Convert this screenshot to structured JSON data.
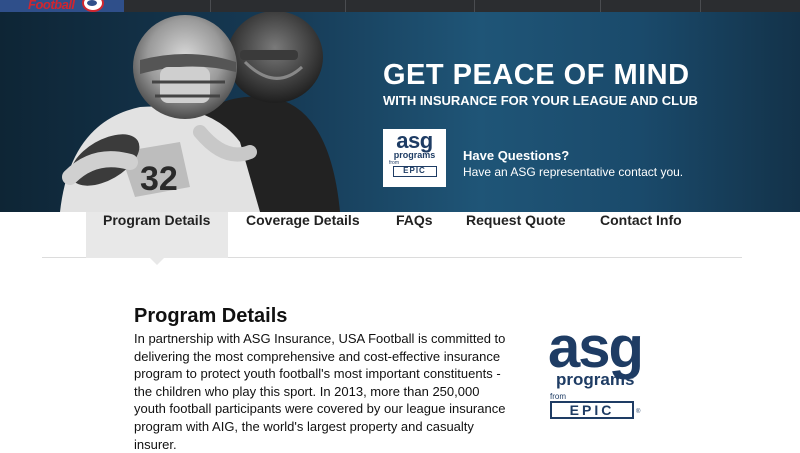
{
  "brand": {
    "logo_text": "Football"
  },
  "hero": {
    "title": "GET PEACE OF MIND",
    "subtitle": "WITH INSURANCE FOR YOUR LEAGUE AND CLUB",
    "asg_logo": {
      "asg": "asg",
      "programs": "programs",
      "from": "from",
      "epic": "EPIC"
    },
    "question_title": "Have Questions?",
    "question_text": "Have an ASG representative contact you.",
    "photo_description": "youth-football-players-photo"
  },
  "tabs": [
    {
      "label": "Program Details",
      "active": true
    },
    {
      "label": "Coverage Details",
      "active": false
    },
    {
      "label": "FAQs",
      "active": false
    },
    {
      "label": "Request Quote",
      "active": false
    },
    {
      "label": "Contact Info",
      "active": false
    }
  ],
  "content": {
    "title": "Program Details",
    "body": "In partnership with ASG Insurance, USA Football is committed to delivering the most comprehensive and cost-effective insurance program to protect youth football's most important constituents - the children who play this sport. In 2013, more than 250,000 youth football participants were covered by our league insurance program with AIG, the world's largest property and casualty insurer."
  },
  "side_logo": {
    "asg": "asg",
    "programs": "programs",
    "from": "from",
    "epic": "EPIC",
    "reg": "®"
  },
  "colors": {
    "brand_navy": "#1e3c64",
    "hero_blue": "#1f5577",
    "active_tab": "#e8e8e8",
    "logo_red": "#d0262f"
  }
}
